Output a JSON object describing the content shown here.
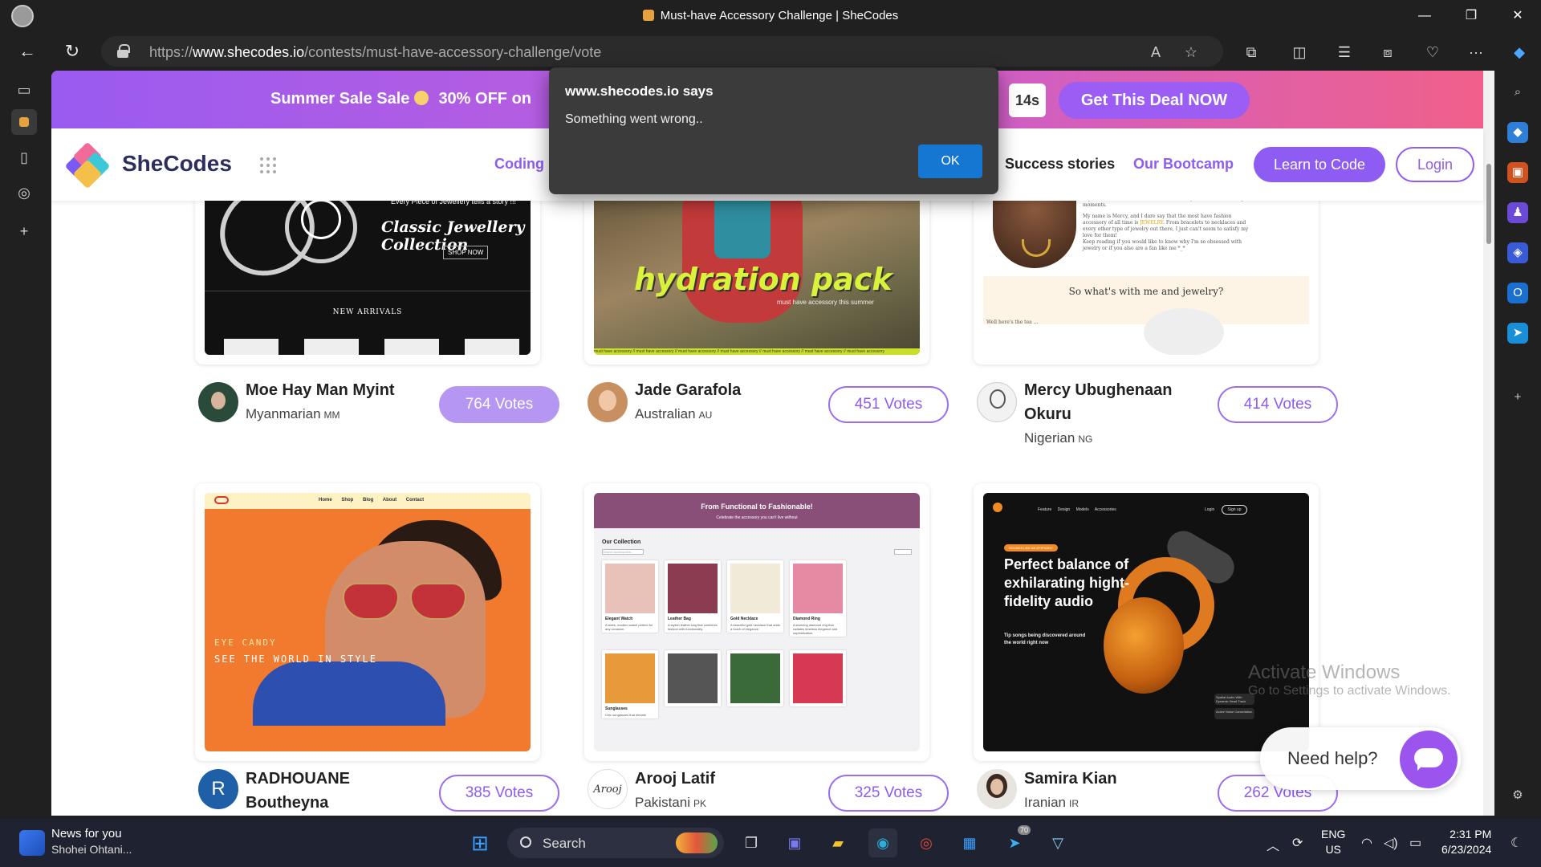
{
  "window": {
    "title": "Must-have Accessory Challenge | SheCodes",
    "minimize": "—",
    "restore": "❐",
    "close": "✕"
  },
  "browser": {
    "url_scheme": "https://",
    "url_domain": "www.shecodes.io",
    "url_path": "/contests/must-have-accessory-challenge/vote",
    "back": "←",
    "refresh": "↻",
    "read_aloud": "A",
    "favorite": "☆",
    "more": "···"
  },
  "promo": {
    "text_left": "Summer Sale Sale",
    "text_right": "30% OFF  on",
    "timer": "14s",
    "cta": "Get This Deal NOW"
  },
  "nav": {
    "brand": "SheCodes",
    "coding": "Coding",
    "success": "Success stories",
    "bootcamp": "Our Bootcamp",
    "learn": "Learn to Code",
    "login": "Login"
  },
  "entries": [
    {
      "name": "Moe Hay Man Myint",
      "nationality": "Myanmarian",
      "code": "MM",
      "votes": "764 Votes"
    },
    {
      "name": "Jade Garafola",
      "nationality": "Australian",
      "code": "AU",
      "votes": "451 Votes"
    },
    {
      "name": "Mercy Ubughenaan Okuru",
      "nationality": "Nigerian",
      "code": "NG",
      "votes": "414 Votes"
    },
    {
      "name": "RADHOUANE Boutheyna",
      "nationality": "",
      "code": "",
      "votes": "385 Votes",
      "initial": "R"
    },
    {
      "name": "Arooj Latif",
      "nationality": "Pakistani",
      "code": "PK",
      "votes": "325 Votes"
    },
    {
      "name": "Samira Kian",
      "nationality": "Iranian",
      "code": "IR",
      "votes": "262 Votes"
    }
  ],
  "thumbs": {
    "jewel": {
      "tagline": "Every Piece of Jewellery tells a story !!!",
      "title": "Classic Jewellery Collection",
      "shop": "SHOP NOW",
      "arrivals": "NEW ARRIVALS"
    },
    "hydra": {
      "word": "hydration pack",
      "sub": "must have accessory this summer",
      "tape": "must have accessory // must have accessory // must have accessory // must have accessory // must have accessory // must have accessory // must have accessory"
    },
    "blog": {
      "p1": "expression, a conversation starter, and a way to celebrate life's special moments.",
      "p2a": "My name is Mercy, and I dare say that the most have fashion accessory of all time is",
      "p2hl": "JEWELRY",
      "p2b": ". From bracelets to necklaces and every other type of jewelry out there, I just can't seem to satisfy my love for them!",
      "p3": "Keep reading if you would like to know why I'm so obsessed with jewelry or if you also are a fan like me *_*",
      "question": "So what's with me and jewelry?",
      "tea": "Well here's the tea ..."
    },
    "shades": {
      "links": "Home Shop Blog About Contact",
      "tag1": "EYE CANDY",
      "tag2": "SEE THE WORLD IN STYLE"
    },
    "catalog": {
      "header": "From Functional to Fashionable!",
      "sub": "Celebrate the accessory you can't live without",
      "collection": "Our Collection",
      "search": "Search accessories...",
      "products": [
        {
          "name": "Elegant Watch",
          "desc": "A sleek, modern watch perfect for any occasion.",
          "color": "#e8c2b8"
        },
        {
          "name": "Leather Bag",
          "desc": "A stylish leather bag that combines fashion with functionality.",
          "color": "#8c3c50"
        },
        {
          "name": "Gold Necklace",
          "desc": "A beautiful gold necklace that adds a touch of elegance.",
          "color": "#f2ead8"
        },
        {
          "name": "Diamond Ring",
          "desc": "A stunning diamond ring that radiates timeless elegance and sophistication.",
          "color": "#e58aa2"
        },
        {
          "name": "Sunglasses",
          "desc": "Chic sunglasses that elevate",
          "color": "#e89a3a"
        },
        {
          "name": "",
          "desc": "",
          "color": "#555555"
        },
        {
          "name": "",
          "desc": "",
          "color": "#3a6a3a"
        },
        {
          "name": "",
          "desc": "",
          "color": "#d63a52"
        }
      ]
    },
    "audio": {
      "links": "Feature Design Models Accessories",
      "login": "Login",
      "signup": "Sign up",
      "chip": "SOUNDS LIKE AN EPIPHANY",
      "headline": "Perfect balance of exhilarating hight-fidelity audio",
      "desc": "Tip songs being discovered around the world right now",
      "mini1": "Spatial Audio With Dynamic Head Track",
      "mini2": "Active Noise Cancellation"
    }
  },
  "dialog": {
    "title": "www.shecodes.io says",
    "message": "Something went wrong..",
    "ok": "OK"
  },
  "overlay": {
    "need_help": "Need help?",
    "watermark1": "Activate Windows",
    "watermark2": "Go to Settings to activate Windows."
  },
  "taskbar": {
    "news_title": "News for you",
    "news_sub": "Shohei Ohtani...",
    "search": "Search",
    "lang1": "ENG",
    "lang2": "US",
    "time": "2:31 PM",
    "date": "6/23/2024",
    "telegram_badge": "70"
  }
}
